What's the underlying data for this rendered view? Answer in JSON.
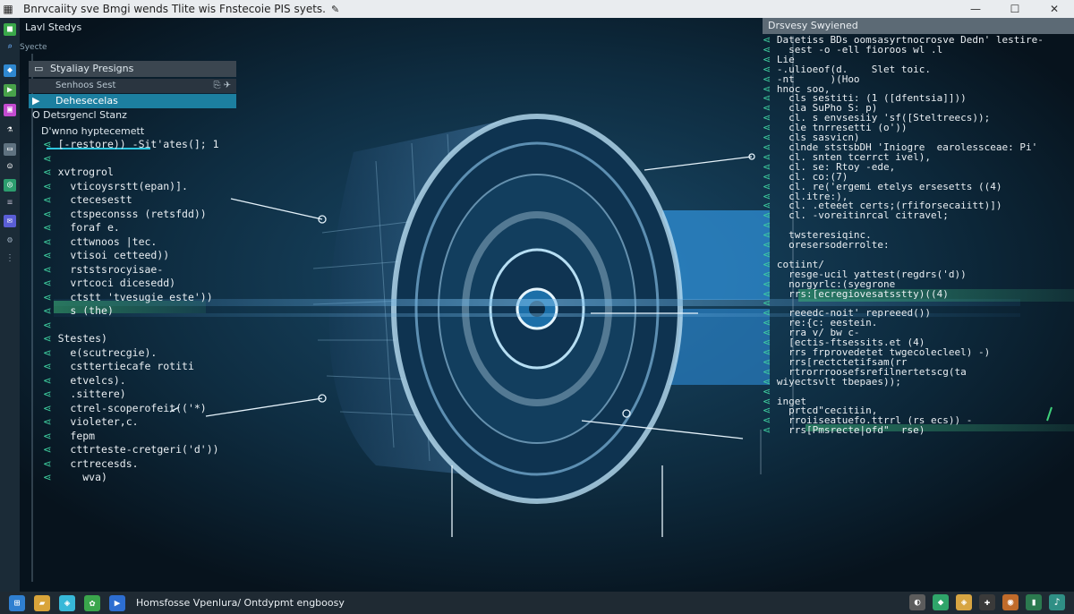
{
  "window": {
    "title": "Bnrvcaiity sve  Bmgi  wends  Tlite wis  Fnstecoie  PIS syets.",
    "minimize": "—",
    "maximize": "☐",
    "close": "✕"
  },
  "left_panel": {
    "header": "Lavl Stedys",
    "subheader": "Syecte",
    "tab_label": "Styaliay   Presigns",
    "row2_label": "Senhoos Sest",
    "selected_label": "Dehesecelas",
    "item1": "Detsrgencl Stanz",
    "item2": "D'wnno hyptecemett"
  },
  "left_code": [
    "[-restore)) -Sit'ates(]; 1",
    "",
    "xvtrogrol",
    "  vticoysrstt(epan)].",
    "  ctecesestt",
    "  ctspeconsss (retsfdd))",
    "  foraf e.",
    "  cttwnoos |tec.",
    "  vtisoi cetteed))",
    "  rststsrocyisae-",
    "  vrtcoci dicesedd)",
    "  ctstt 'tvesugie este'))",
    "  s (the)",
    "",
    "Stestes)",
    "  e(scutrecgie).",
    "  csttertiecafe rotiti",
    "  etvelcs).",
    "  .sittere)",
    "  ctrel-scoperofeit(('*)",
    "  violeter,c.",
    "  fepm",
    "  cttrteste-cretgeri('d'))",
    "  crtrecesds.",
    "    wva)"
  ],
  "right_panel": {
    "header": "Drsvesy Swyiened"
  },
  "right_code": [
    "Datetiss BDs oomsasyrtnocrosve Dedn' lestire-",
    "  sest -o -ell fioroos wl .l",
    "Lie",
    "-.ulioeof(d.    Slet toic.",
    "-nt      )(Hoo",
    "hnoc soo,",
    "  cls sestiti: (1 ([dfentsia]]))",
    "  cla SuPho S: p)",
    "  cl. s envsesiiy 'sf([Steltreecs));",
    "  cle tnrresetti (o'))",
    "  cls sasvicn)",
    "  clnde ststsbDH 'Iniogre  earolessceae: Pi'",
    "  cl. snten tcerrct ivel),",
    "  cl. se: Rtoy -ede,",
    "  cl. co:(7)",
    "  cl. re('ergemi etelys ersesetts ((4)",
    "  cl.itre:),",
    "  cl. .eteeet certs;(rfiforsecaiitt)])",
    "  cl. -voreitinrcal citravel;",
    "",
    "  twsteresiqinc.",
    "  oresersoderrolte:",
    "",
    "cotiint/",
    "  resge-ucil yattest(regdrs('d))",
    "  norgyrlc:(syegrone",
    "  rrs:[ecregiovesatsstty)((4)",
    "",
    "  reeedc-noit' repreeed())",
    "  re:{c: eestein.",
    "  rra v/ bw c-",
    "  [ectis-ftsessits.et (4)",
    "  rrs frprovedetet twgecolecleel) -)",
    "  rrs[rectctetifsam(rr",
    "  rtrorrroosefsrefilnertetscg(ta",
    "wiyectsvlt tbepaes));",
    "",
    "inget",
    "  prtcd\"cecitiin,",
    "  rroiiseatuefo.ttrrl (rs ecs)) -",
    "  rrs[Pmsrecte|ofd\"  rse)"
  ],
  "taskbar": {
    "label": "Homsfosse Vpenlura/ Ontdypmt engboosy"
  }
}
